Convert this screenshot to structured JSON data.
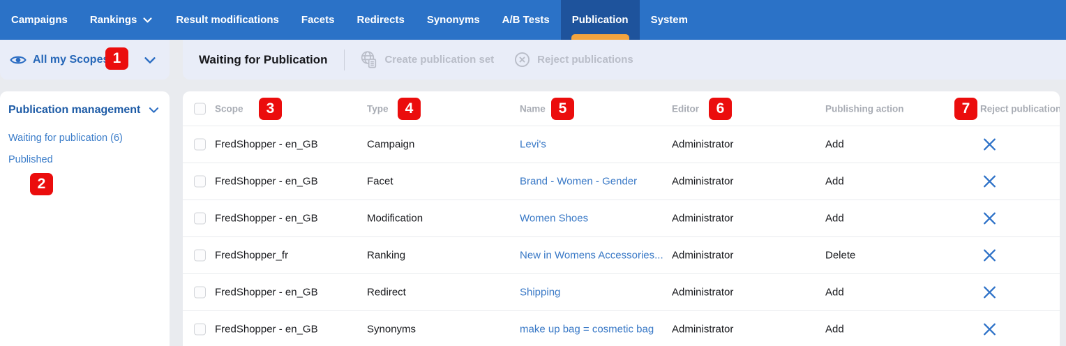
{
  "nav": {
    "items": [
      {
        "label": "Campaigns"
      },
      {
        "label": "Rankings"
      },
      {
        "label": "Result modifications"
      },
      {
        "label": "Facets"
      },
      {
        "label": "Redirects"
      },
      {
        "label": "Synonyms"
      },
      {
        "label": "A/B Tests"
      },
      {
        "label": "Publication"
      },
      {
        "label": "System"
      }
    ]
  },
  "scope_bar": {
    "label": "All my Scopes"
  },
  "toolbar": {
    "title": "Waiting for Publication",
    "create_button": "Create publication set",
    "reject_button": "Reject publications"
  },
  "sidebar": {
    "heading": "Publication management",
    "items": [
      {
        "label": "Waiting for publication (6)"
      },
      {
        "label": "Published"
      }
    ]
  },
  "table": {
    "columns": {
      "scope": "Scope",
      "type": "Type",
      "name": "Name",
      "editor": "Editor",
      "action": "Publishing action",
      "reject": "Reject publication"
    },
    "rows": [
      {
        "scope": "FredShopper - en_GB",
        "type": "Campaign",
        "name": "Levi's",
        "editor": "Administrator",
        "action": "Add"
      },
      {
        "scope": "FredShopper - en_GB",
        "type": "Facet",
        "name": "Brand - Women - Gender",
        "editor": "Administrator",
        "action": "Add"
      },
      {
        "scope": "FredShopper - en_GB",
        "type": "Modification",
        "name": "Women Shoes",
        "editor": "Administrator",
        "action": "Add"
      },
      {
        "scope": "FredShopper_fr",
        "type": "Ranking",
        "name": "New in Womens Accessories...",
        "editor": "Administrator",
        "action": "Delete"
      },
      {
        "scope": "FredShopper - en_GB",
        "type": "Redirect",
        "name": "Shipping",
        "editor": "Administrator",
        "action": "Add"
      },
      {
        "scope": "FredShopper - en_GB",
        "type": "Synonyms",
        "name": "make up bag = cosmetic bag",
        "editor": "Administrator",
        "action": "Add"
      }
    ]
  },
  "annotations": {
    "badges": [
      "1",
      "2",
      "3",
      "4",
      "5",
      "6",
      "7"
    ]
  },
  "colors": {
    "nav_blue": "#2b72c7",
    "active_tab_blue": "#1e539c",
    "tab_indicator_orange": "#f3a43f",
    "panel_lavender": "#e9edf8",
    "link_blue": "#3878c6",
    "sidebar_heading_blue": "#1d5ba6",
    "annotation_red": "#eb0d0d",
    "disabled_gray": "#b9bdc8",
    "reject_x_blue": "#2e72c8"
  }
}
